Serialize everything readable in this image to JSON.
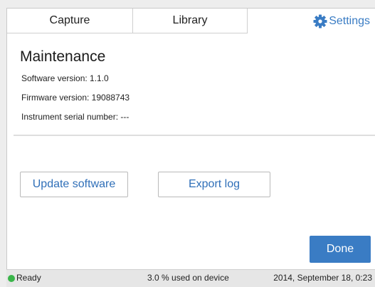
{
  "tabs": {
    "capture": "Capture",
    "library": "Library",
    "settings": "Settings",
    "settings_icon": "gear-icon",
    "active": "settings"
  },
  "page": {
    "title": "Maintenance",
    "software_version": "Software version: 1.1.0",
    "firmware_version": "Firmware version: 19088743",
    "serial_number": "Instrument serial number: ---"
  },
  "actions": {
    "update_software": "Update software",
    "export_log": "Export log",
    "done": "Done"
  },
  "status_bar": {
    "ready": "Ready",
    "usage": "3.0 % used on device",
    "datetime": "2014, September 18, 0:23"
  },
  "colors": {
    "accent": "#3a7cc4",
    "status_ok": "#3ab54a"
  }
}
